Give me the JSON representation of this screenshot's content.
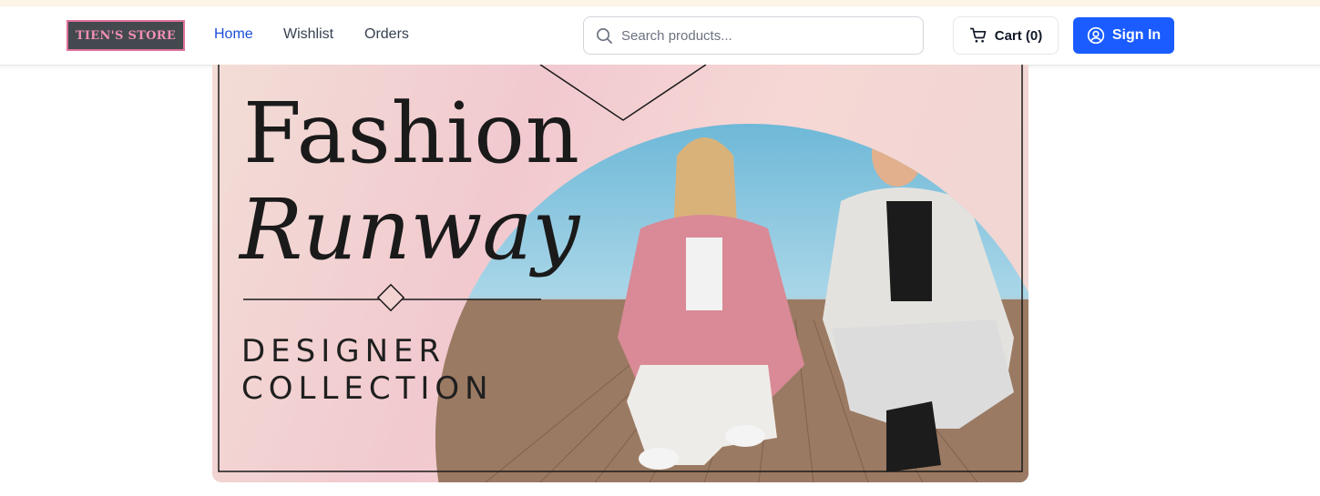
{
  "brand": {
    "logo_text": "TIEN'S STORE"
  },
  "nav": {
    "home": "Home",
    "wishlist": "Wishlist",
    "orders": "Orders"
  },
  "search": {
    "placeholder": "Search products...",
    "value": ""
  },
  "cart": {
    "label": "Cart (0)"
  },
  "auth": {
    "signin_label": "Sign In"
  },
  "banner": {
    "headline_1": "Fashion",
    "headline_2": "Runway",
    "subline_1": "DESIGNER",
    "subline_2": "COLLECTION"
  },
  "colors": {
    "accent": "#1a5cff",
    "active_link": "#1d4ed8",
    "logo_bg": "#444950",
    "logo_text": "#f08fb3"
  }
}
